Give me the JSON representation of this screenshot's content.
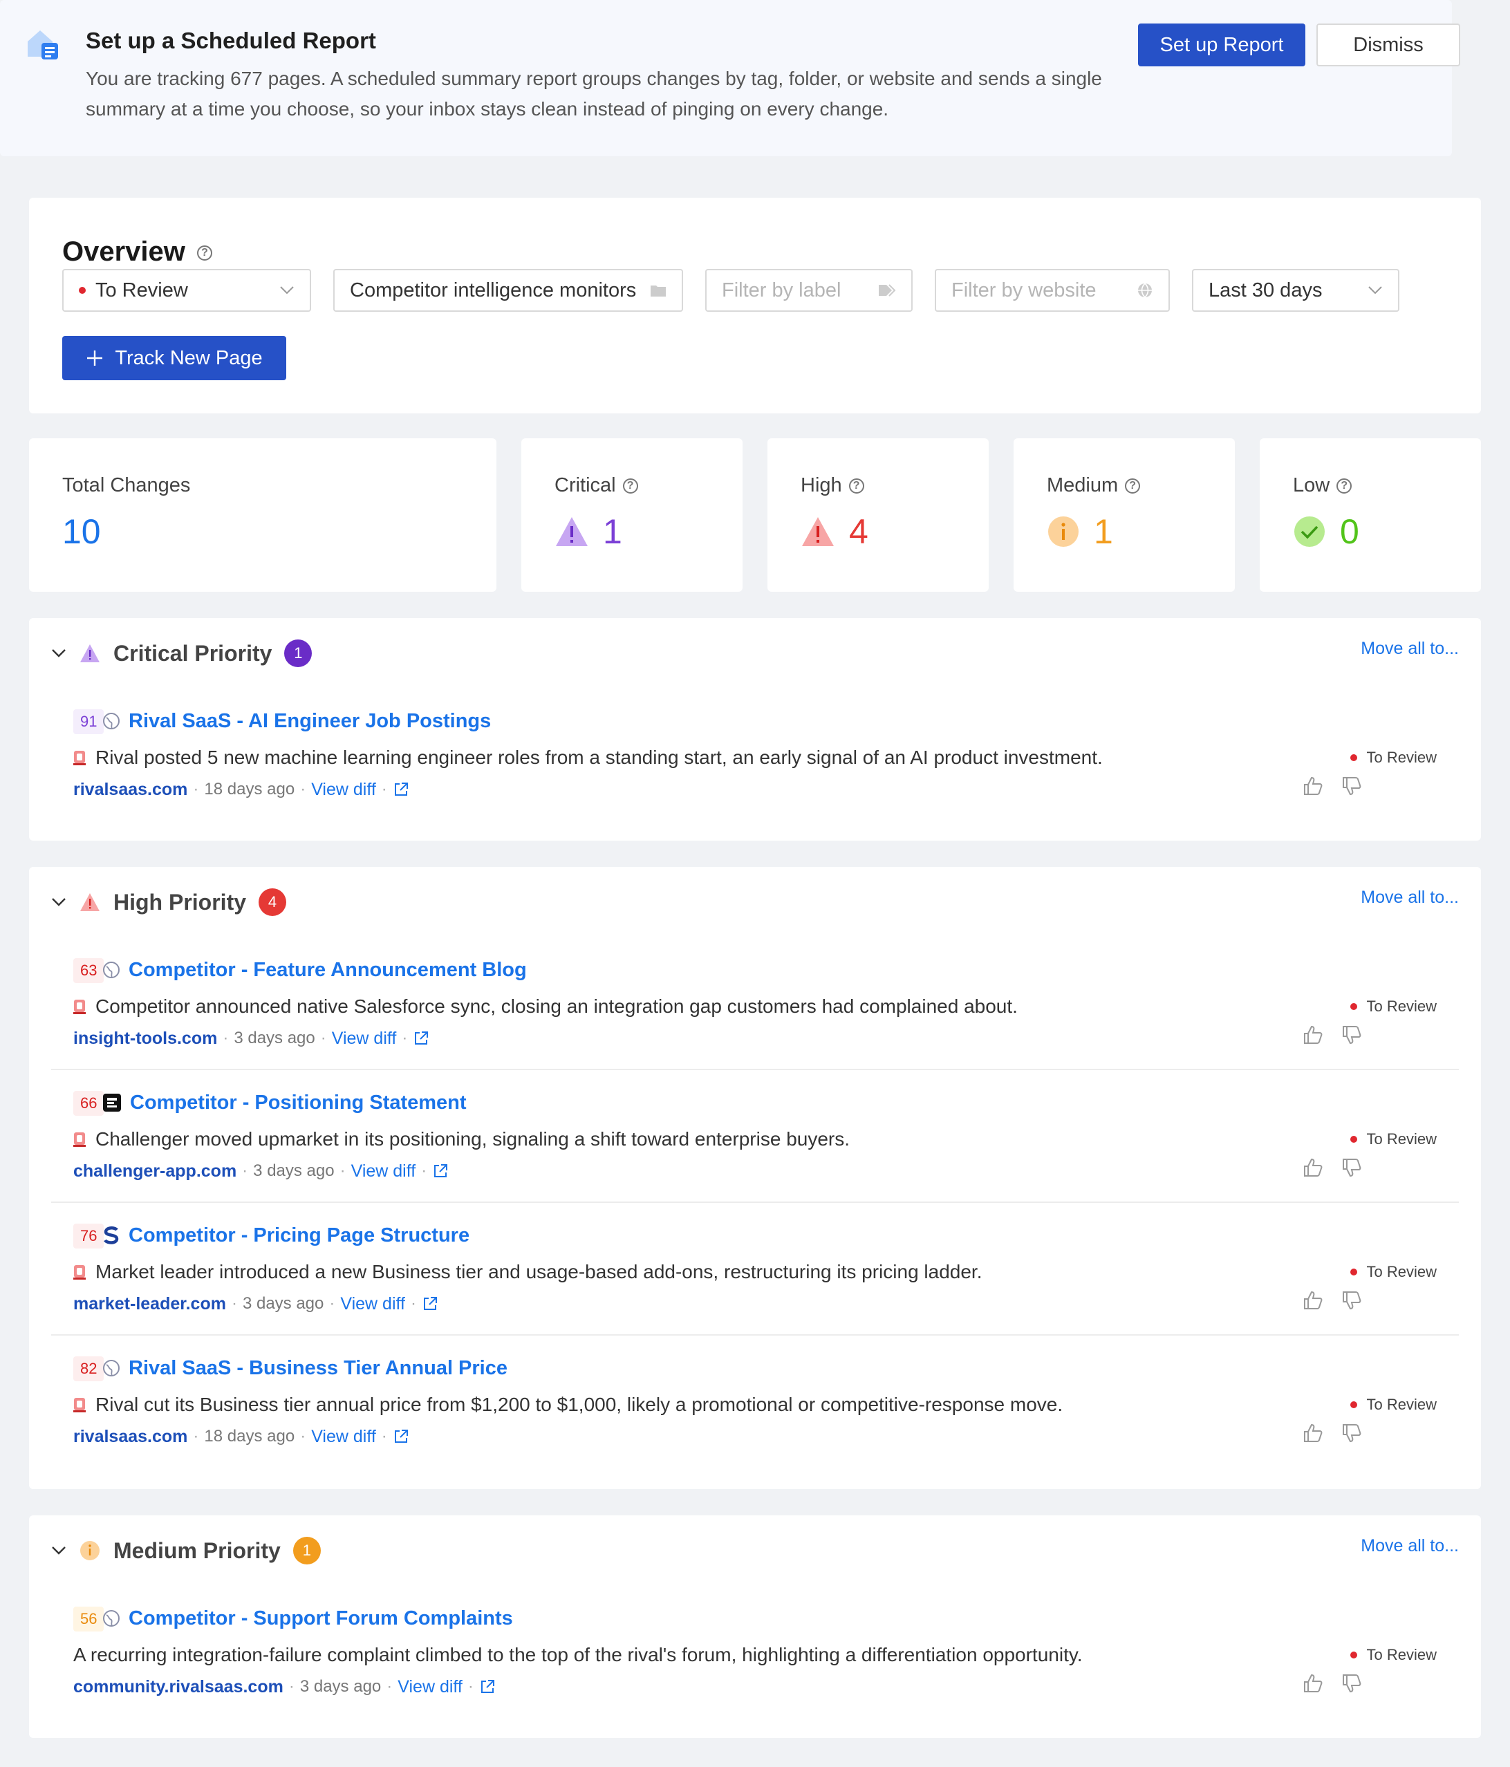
{
  "banner": {
    "title": "Set up a Scheduled Report",
    "text": "You are tracking 677 pages. A scheduled summary report groups changes by tag, folder, or website and sends a single summary at a time you choose, so your inbox stays clean instead of pinging on every change.",
    "setup_button": "Set up Report",
    "dismiss_button": "Dismiss"
  },
  "overview": {
    "title": "Overview",
    "status_select": "To Review",
    "folder_select": "Competitor intelligence monitors",
    "label_placeholder": "Filter by label",
    "website_placeholder": "Filter by website",
    "period_select": "Last 30 days",
    "track_button": "Track New Page"
  },
  "stats": {
    "total": {
      "label": "Total Changes",
      "value": "10"
    },
    "critical": {
      "label": "Critical",
      "value": "1"
    },
    "high": {
      "label": "High",
      "value": "4"
    },
    "medium": {
      "label": "Medium",
      "value": "1"
    },
    "low": {
      "label": "Low",
      "value": "0"
    }
  },
  "colors": {
    "critical": "#7b3fd6",
    "high": "#e53935",
    "medium": "#f29d1e",
    "low": "#52c41a",
    "link": "#1a73e8",
    "primary": "#2651c7"
  },
  "sections": {
    "critical": {
      "title": "Critical Priority",
      "count": "1",
      "move_all": "Move all to...",
      "items": [
        {
          "score": "91",
          "title": "Rival SaaS - AI Engineer Job Postings",
          "desc": "Rival posted 5 new machine learning engineer roles from a standing start, an early signal of an AI product investment.",
          "domain": "rivalsaas.com",
          "age": "18 days ago",
          "view_diff": "View diff",
          "status": "To Review",
          "icon": "globe-icon"
        }
      ]
    },
    "high": {
      "title": "High Priority",
      "count": "4",
      "move_all": "Move all to...",
      "items": [
        {
          "score": "63",
          "title": "Competitor - Feature Announcement Blog",
          "desc": "Competitor announced native Salesforce sync, closing an integration gap customers had complained about.",
          "domain": "insight-tools.com",
          "age": "3 days ago",
          "view_diff": "View diff",
          "status": "To Review",
          "icon": "globe-icon"
        },
        {
          "score": "66",
          "title": "Competitor - Positioning Statement",
          "desc": "Challenger moved upmarket in its positioning, signaling a shift toward enterprise buyers.",
          "domain": "challenger-app.com",
          "age": "3 days ago",
          "view_diff": "View diff",
          "status": "To Review",
          "icon": "challenger-logo-icon"
        },
        {
          "score": "76",
          "title": "Competitor - Pricing Page Structure",
          "desc": "Market leader introduced a new Business tier and usage-based add-ons, restructuring its pricing ladder.",
          "domain": "market-leader.com",
          "age": "3 days ago",
          "view_diff": "View diff",
          "status": "To Review",
          "icon": "s-logo-icon"
        },
        {
          "score": "82",
          "title": "Rival SaaS - Business Tier Annual Price",
          "desc": "Rival cut its Business tier annual price from $1,200 to $1,000, likely a promotional or competitive-response move.",
          "domain": "rivalsaas.com",
          "age": "18 days ago",
          "view_diff": "View diff",
          "status": "To Review",
          "icon": "globe-icon"
        }
      ]
    },
    "medium": {
      "title": "Medium Priority",
      "count": "1",
      "move_all": "Move all to...",
      "items": [
        {
          "score": "56",
          "title": "Competitor - Support Forum Complaints",
          "desc": "A recurring integration-failure complaint climbed to the top of the rival's forum, highlighting a differentiation opportunity.",
          "domain": "community.rivalsaas.com",
          "age": "3 days ago",
          "view_diff": "View diff",
          "status": "To Review",
          "icon": "globe-icon"
        }
      ]
    }
  }
}
